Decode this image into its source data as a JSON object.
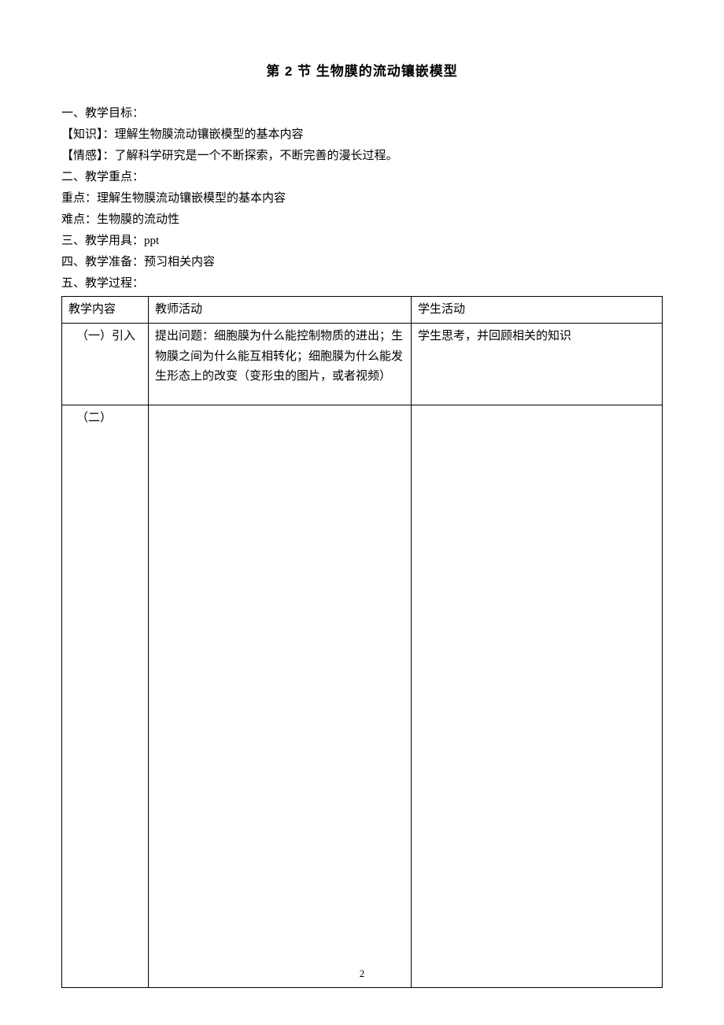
{
  "title": "第 2 节  生物膜的流动镶嵌模型",
  "lines": {
    "l1": "一、教学目标：",
    "l2": "【知识】：理解生物膜流动镶嵌模型的基本内容",
    "l3": "【情感】：了解科学研究是一个不断探索，不断完善的漫长过程。",
    "l4": "二、教学重点：",
    "l5": "重点：理解生物膜流动镶嵌模型的基本内容",
    "l6": "难点：生物膜的流动性",
    "l7": "三、教学用具：ppt",
    "l8": "四、教学准备：预习相关内容",
    "l9": "五、教学过程："
  },
  "table": {
    "header": {
      "c1": "教学内容",
      "c2": "教师活动",
      "c3": "学生活动"
    },
    "row1": {
      "c1": "（一）引入",
      "c2": "提出问题：细胞膜为什么能控制物质的进出；生物膜之间为什么能互相转化；细胞膜为什么能发生形态上的改变（变形虫的图片，或者视频）",
      "c3": "学生思考，并回顾相关的知识"
    },
    "row2": {
      "c1": "（二）",
      "c2": "",
      "c3": ""
    }
  },
  "pageNumber": "2"
}
